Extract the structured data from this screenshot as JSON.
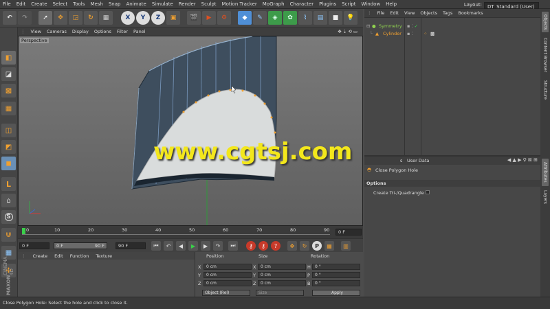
{
  "menu": [
    "File",
    "Edit",
    "Create",
    "Select",
    "Tools",
    "Mesh",
    "Snap",
    "Animate",
    "Simulate",
    "Render",
    "Sculpt",
    "Motion Tracker",
    "MoGraph",
    "Character",
    "Plugins",
    "Script",
    "Window",
    "Help"
  ],
  "layout": {
    "label": "Layout:",
    "value": "DT_Standard (User)"
  },
  "toolbar": {
    "x_label": "X",
    "y_label": "Y",
    "z_label": "Z"
  },
  "viewport": {
    "menu": [
      "View",
      "Cameras",
      "Display",
      "Options",
      "Filter",
      "Panel"
    ],
    "label": "Perspective",
    "watermark": "www.cgtsj.com"
  },
  "timeline": {
    "ticks": [
      "0",
      "10",
      "20",
      "30",
      "40",
      "50",
      "60",
      "70",
      "80",
      "90"
    ],
    "current_frame": "0 F"
  },
  "transport": {
    "start": "0 F",
    "range_start": "0 F",
    "range_end": "90 F",
    "end": "90 F"
  },
  "material_manager": {
    "menu": [
      "Create",
      "Edit",
      "Function",
      "Texture"
    ]
  },
  "coordinates": {
    "headers": {
      "position": "Position",
      "size": "Size",
      "rotation": "Rotation"
    },
    "rows": [
      {
        "axis": "X",
        "pos": "0 cm",
        "size_axis": "X",
        "size": "0 cm",
        "rot_axis": "H",
        "rot": "0 °"
      },
      {
        "axis": "Y",
        "pos": "0 cm",
        "size_axis": "Y",
        "size": "0 cm",
        "rot_axis": "P",
        "rot": "0 °"
      },
      {
        "axis": "Z",
        "pos": "0 cm",
        "size_axis": "Z",
        "size": "0 cm",
        "rot_axis": "B",
        "rot": "0 °"
      }
    ],
    "mode": "Object (Rel)",
    "size_mode": "Size",
    "apply": "Apply"
  },
  "object_manager": {
    "menu": [
      "File",
      "Edit",
      "View",
      "Objects",
      "Tags",
      "Bookmarks"
    ],
    "objects": [
      {
        "name": "Symmetry",
        "color": "#8fd14f"
      },
      {
        "name": "Cylinder",
        "color": "#f0a030"
      }
    ]
  },
  "attributes": {
    "tab": "User Data",
    "tool_name": "Close Polygon Hole",
    "section": "Options",
    "option_label": "Create Tri-/Quadrangle"
  },
  "right_tabs": [
    "Objects",
    "Content Browser",
    "Structure",
    "Attributes",
    "Layers"
  ],
  "brand": {
    "line1": "MAXON",
    "line2": "CINEMA 4D"
  },
  "status": "Close Polygon Hole: Select the hole and click to close it."
}
